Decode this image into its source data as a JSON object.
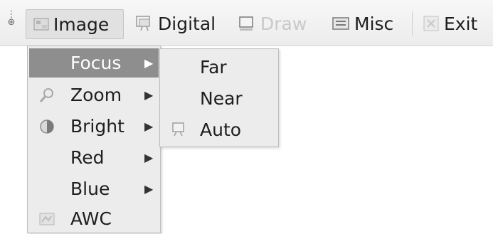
{
  "menubar": {
    "items": [
      {
        "label": "Image",
        "icon": "image-icon",
        "state": "open"
      },
      {
        "label": "Digital",
        "icon": "digital-icon",
        "state": "normal"
      },
      {
        "label": "Draw",
        "icon": "draw-icon",
        "state": "disabled"
      },
      {
        "label": "Misc",
        "icon": "misc-icon",
        "state": "normal"
      },
      {
        "label": "Exit",
        "icon": "exit-icon",
        "state": "normal"
      }
    ]
  },
  "image_menu": {
    "items": [
      {
        "label": "Focus",
        "icon": "",
        "has_submenu": true,
        "highlighted": true
      },
      {
        "label": "Zoom",
        "icon": "magnifier-icon",
        "has_submenu": true
      },
      {
        "label": "Bright",
        "icon": "bright-icon",
        "has_submenu": true
      },
      {
        "label": "Red",
        "icon": "",
        "has_submenu": true
      },
      {
        "label": "Blue",
        "icon": "",
        "has_submenu": true
      },
      {
        "label": "AWC",
        "icon": "awc-icon",
        "has_submenu": false
      }
    ],
    "arrow_glyph": "▶"
  },
  "focus_submenu": {
    "items": [
      {
        "label": "Far",
        "icon": ""
      },
      {
        "label": "Near",
        "icon": ""
      },
      {
        "label": "Auto",
        "icon": "auto-icon"
      }
    ]
  },
  "colors": {
    "menubar_bg": "#efefef",
    "highlight_bg": "#8e8e8e",
    "menu_bg": "#ececec",
    "disabled_text": "#c9c9c9"
  }
}
